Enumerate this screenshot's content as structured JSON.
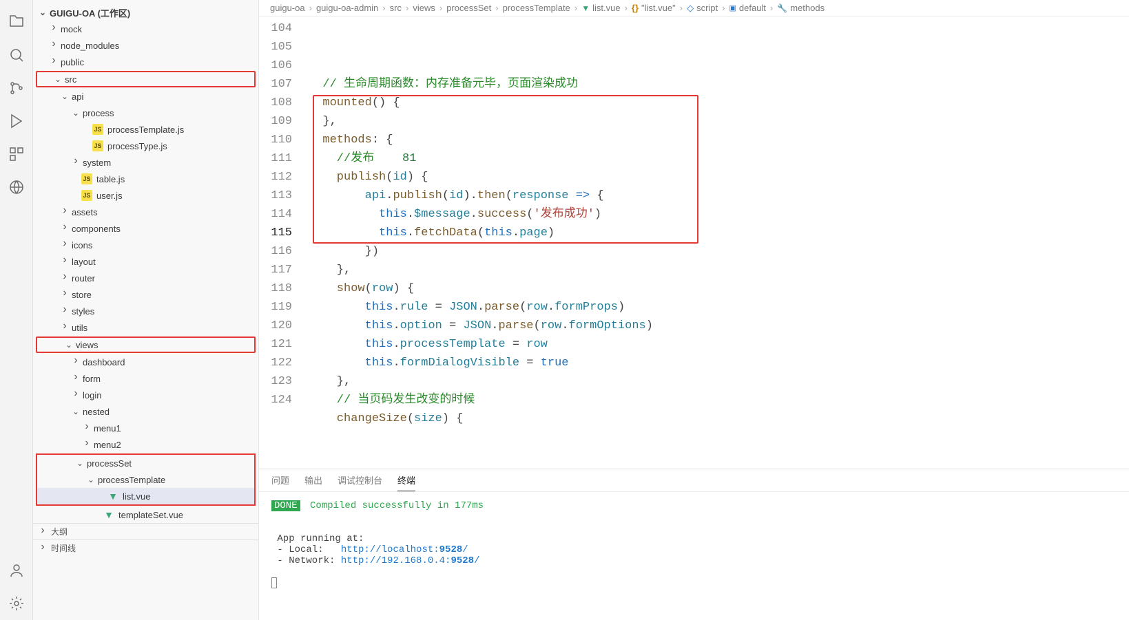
{
  "sidebar": {
    "workspace": "GUIGU-OA (工作区)",
    "outline": "大纲",
    "timeline": "时间线",
    "tree": [
      {
        "indent": 1,
        "chev": "right",
        "label": "mock"
      },
      {
        "indent": 1,
        "chev": "right",
        "label": "node_modules"
      },
      {
        "indent": 1,
        "chev": "right",
        "label": "public"
      },
      {
        "indent": 1,
        "chev": "down",
        "label": "src",
        "hl": true
      },
      {
        "indent": 2,
        "chev": "down",
        "label": "api"
      },
      {
        "indent": 3,
        "chev": "down",
        "label": "process"
      },
      {
        "indent": 4,
        "icon": "js",
        "label": "processTemplate.js"
      },
      {
        "indent": 4,
        "icon": "js",
        "label": "processType.js"
      },
      {
        "indent": 3,
        "chev": "right",
        "label": "system"
      },
      {
        "indent": 3,
        "icon": "js",
        "label": "table.js"
      },
      {
        "indent": 3,
        "icon": "js",
        "label": "user.js"
      },
      {
        "indent": 2,
        "chev": "right",
        "label": "assets"
      },
      {
        "indent": 2,
        "chev": "right",
        "label": "components"
      },
      {
        "indent": 2,
        "chev": "right",
        "label": "icons"
      },
      {
        "indent": 2,
        "chev": "right",
        "label": "layout"
      },
      {
        "indent": 2,
        "chev": "right",
        "label": "router"
      },
      {
        "indent": 2,
        "chev": "right",
        "label": "store"
      },
      {
        "indent": 2,
        "chev": "right",
        "label": "styles"
      },
      {
        "indent": 2,
        "chev": "right",
        "label": "utils"
      },
      {
        "indent": 2,
        "chev": "down",
        "label": "views",
        "hl": true
      },
      {
        "indent": 3,
        "chev": "right",
        "label": "dashboard"
      },
      {
        "indent": 3,
        "chev": "right",
        "label": "form"
      },
      {
        "indent": 3,
        "chev": "right",
        "label": "login"
      },
      {
        "indent": 3,
        "chev": "down",
        "label": "nested"
      },
      {
        "indent": 4,
        "chev": "right",
        "label": "menu1"
      },
      {
        "indent": 4,
        "chev": "right",
        "label": "menu2"
      },
      {
        "indent": 3,
        "chev": "down",
        "label": "processSet",
        "hl": true,
        "hlGroup": "ps"
      },
      {
        "indent": 4,
        "chev": "down",
        "label": "processTemplate",
        "hl": true,
        "hlGroup": "ps"
      },
      {
        "indent": 5,
        "icon": "vue",
        "label": "list.vue",
        "hl": true,
        "hlGroup": "ps",
        "selected": true
      },
      {
        "indent": 5,
        "icon": "vue",
        "label": "templateSet.vue"
      }
    ]
  },
  "breadcrumbs": [
    {
      "label": "guigu-oa"
    },
    {
      "label": "guigu-oa-admin"
    },
    {
      "label": "src"
    },
    {
      "label": "views"
    },
    {
      "label": "processSet"
    },
    {
      "label": "processTemplate"
    },
    {
      "icon": "vue",
      "label": "list.vue"
    },
    {
      "icon": "braces",
      "label": "\"list.vue\""
    },
    {
      "icon": "script",
      "label": "script"
    },
    {
      "icon": "default",
      "label": "default"
    },
    {
      "icon": "methods",
      "label": "methods"
    }
  ],
  "code": {
    "startLine": 104,
    "currentLine": 115,
    "lines": [
      [
        {
          "c": "cmt",
          "t": "  // 生命周期函数：内存准备元毕，页面渲染成功"
        }
      ],
      [
        {
          "c": "fn",
          "t": "  mounted"
        },
        {
          "c": "pun",
          "t": "() {"
        }
      ],
      [
        {
          "c": "pun",
          "t": "  },"
        }
      ],
      [
        {
          "c": "fn",
          "t": "  methods"
        },
        {
          "c": "pun",
          "t": ": "
        },
        {
          "c": "pun",
          "t": "{",
          "cursor": true
        }
      ],
      [
        {
          "c": "cmt",
          "t": "    //发布"
        },
        {
          "c": "pun",
          "t": "    "
        },
        {
          "c": "num",
          "t": "81"
        }
      ],
      [
        {
          "c": "fn",
          "t": "    publish"
        },
        {
          "c": "pun",
          "t": "("
        },
        {
          "c": "var",
          "t": "id"
        },
        {
          "c": "pun",
          "t": ") {"
        }
      ],
      [
        {
          "c": "pun",
          "t": "        "
        },
        {
          "c": "var",
          "t": "api"
        },
        {
          "c": "pun",
          "t": "."
        },
        {
          "c": "fn",
          "t": "publish"
        },
        {
          "c": "pun",
          "t": "("
        },
        {
          "c": "var",
          "t": "id"
        },
        {
          "c": "pun",
          "t": ")."
        },
        {
          "c": "fn",
          "t": "then"
        },
        {
          "c": "pun",
          "t": "("
        },
        {
          "c": "var",
          "t": "response"
        },
        {
          "c": "pun",
          "t": " "
        },
        {
          "c": "kw",
          "t": "=>"
        },
        {
          "c": "pun",
          "t": " {"
        }
      ],
      [
        {
          "c": "pun",
          "t": "          "
        },
        {
          "c": "this",
          "t": "this"
        },
        {
          "c": "pun",
          "t": "."
        },
        {
          "c": "var",
          "t": "$message"
        },
        {
          "c": "pun",
          "t": "."
        },
        {
          "c": "fn",
          "t": "success"
        },
        {
          "c": "pun",
          "t": "("
        },
        {
          "c": "str",
          "t": "'发布成功'"
        },
        {
          "c": "pun",
          "t": ")"
        }
      ],
      [
        {
          "c": "pun",
          "t": "          "
        },
        {
          "c": "this",
          "t": "this"
        },
        {
          "c": "pun",
          "t": "."
        },
        {
          "c": "fn",
          "t": "fetchData"
        },
        {
          "c": "pun",
          "t": "("
        },
        {
          "c": "this",
          "t": "this"
        },
        {
          "c": "pun",
          "t": "."
        },
        {
          "c": "var",
          "t": "page"
        },
        {
          "c": "pun",
          "t": ")"
        }
      ],
      [
        {
          "c": "pun",
          "t": "        })"
        }
      ],
      [
        {
          "c": "pun",
          "t": "    },"
        }
      ],
      [
        {
          "c": "pun",
          "t": ""
        }
      ],
      [
        {
          "c": "fn",
          "t": "    show"
        },
        {
          "c": "pun",
          "t": "("
        },
        {
          "c": "var",
          "t": "row"
        },
        {
          "c": "pun",
          "t": ") {"
        }
      ],
      [
        {
          "c": "pun",
          "t": "        "
        },
        {
          "c": "this",
          "t": "this"
        },
        {
          "c": "pun",
          "t": "."
        },
        {
          "c": "var",
          "t": "rule"
        },
        {
          "c": "pun",
          "t": " = "
        },
        {
          "c": "var",
          "t": "JSON"
        },
        {
          "c": "pun",
          "t": "."
        },
        {
          "c": "fn",
          "t": "parse"
        },
        {
          "c": "pun",
          "t": "("
        },
        {
          "c": "var",
          "t": "row"
        },
        {
          "c": "pun",
          "t": "."
        },
        {
          "c": "var",
          "t": "formProps"
        },
        {
          "c": "pun",
          "t": ")"
        }
      ],
      [
        {
          "c": "pun",
          "t": "        "
        },
        {
          "c": "this",
          "t": "this"
        },
        {
          "c": "pun",
          "t": "."
        },
        {
          "c": "var",
          "t": "option"
        },
        {
          "c": "pun",
          "t": " = "
        },
        {
          "c": "var",
          "t": "JSON"
        },
        {
          "c": "pun",
          "t": "."
        },
        {
          "c": "fn",
          "t": "parse"
        },
        {
          "c": "pun",
          "t": "("
        },
        {
          "c": "var",
          "t": "row"
        },
        {
          "c": "pun",
          "t": "."
        },
        {
          "c": "var",
          "t": "formOptions"
        },
        {
          "c": "pun",
          "t": ")"
        }
      ],
      [
        {
          "c": "pun",
          "t": "        "
        },
        {
          "c": "this",
          "t": "this"
        },
        {
          "c": "pun",
          "t": "."
        },
        {
          "c": "var",
          "t": "processTemplate"
        },
        {
          "c": "pun",
          "t": " = "
        },
        {
          "c": "var",
          "t": "row"
        }
      ],
      [
        {
          "c": "pun",
          "t": "        "
        },
        {
          "c": "this",
          "t": "this"
        },
        {
          "c": "pun",
          "t": "."
        },
        {
          "c": "var",
          "t": "formDialogVisible"
        },
        {
          "c": "pun",
          "t": " = "
        },
        {
          "c": "const",
          "t": "true"
        }
      ],
      [
        {
          "c": "pun",
          "t": "    },"
        }
      ],
      [
        {
          "c": "pun",
          "t": ""
        }
      ],
      [
        {
          "c": "cmt",
          "t": "    // 当页码发生改变的时候"
        }
      ],
      [
        {
          "c": "fn",
          "t": "    changeSize"
        },
        {
          "c": "pun",
          "t": "("
        },
        {
          "c": "var",
          "t": "size"
        },
        {
          "c": "pun",
          "t": ") {"
        }
      ]
    ]
  },
  "panel": {
    "tabs": [
      {
        "label": "问题",
        "active": false
      },
      {
        "label": "输出",
        "active": false
      },
      {
        "label": "调试控制台",
        "active": false
      },
      {
        "label": "终端",
        "active": true
      }
    ],
    "terminal": {
      "doneBadge": "DONE",
      "doneMsg": " Compiled successfully in 177ms",
      "appRunning": " App running at:",
      "localLabel": " - Local:   ",
      "localUrl": "http://localhost:",
      "localPort": "9528",
      "localSuffix": "/",
      "networkLabel": " - Network: ",
      "networkUrl": "http://192.168.0.4:",
      "networkPort": "9528",
      "networkSuffix": "/"
    }
  }
}
